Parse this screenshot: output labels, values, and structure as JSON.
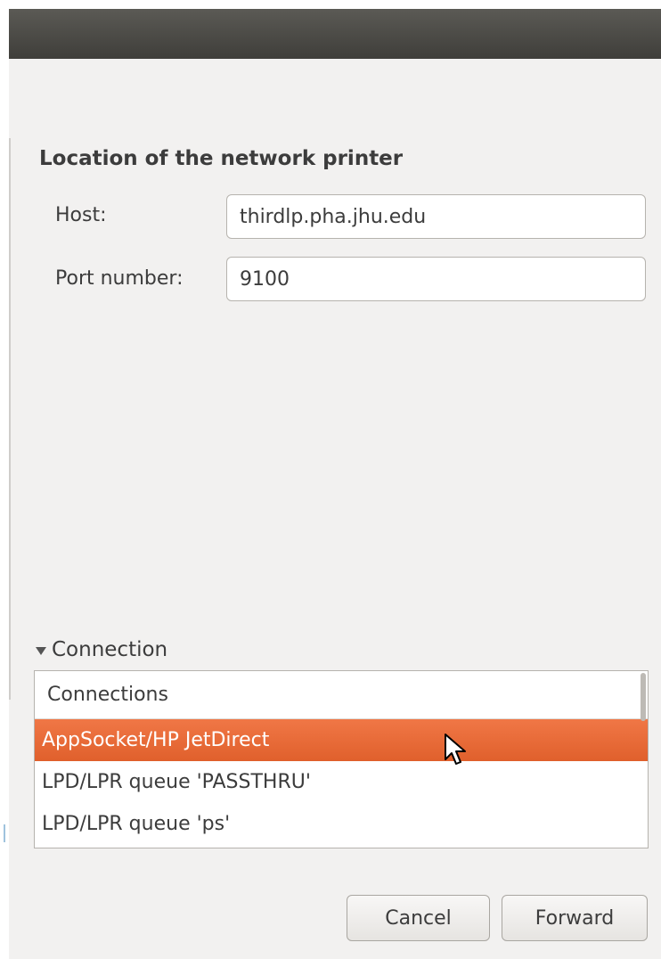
{
  "location": {
    "title": "Location of the network printer",
    "host_label": "Host:",
    "host_value": "thirdlp.pha.jhu.edu",
    "port_label": "Port number:",
    "port_value": "9100"
  },
  "connection": {
    "expander_label": "Connection",
    "list_header": "Connections",
    "items": [
      {
        "label": "AppSocket/HP JetDirect",
        "selected": true
      },
      {
        "label": "LPD/LPR queue 'PASSTHRU'",
        "selected": false
      },
      {
        "label": "LPD/LPR queue 'ps'",
        "selected": false
      }
    ]
  },
  "buttons": {
    "cancel": "Cancel",
    "forward": "Forward"
  },
  "colors": {
    "accent": "#e9683a",
    "titlebar": "#4a4945"
  }
}
